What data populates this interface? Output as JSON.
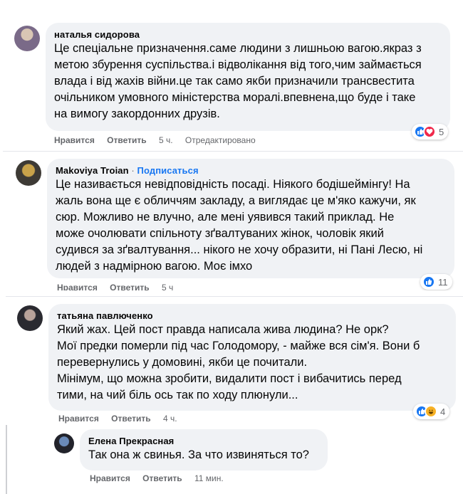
{
  "comments": [
    {
      "author": "наталья сидорова",
      "lines": [
        "Це спеціальне призначення.саме людини з лишньою вагою.якраз з",
        "метою збурення суспільства.і відволікання від того,чим займається",
        "влада і від жахів війни.це так само якби призначили трансвестита",
        "очільником умовного міністерства моралі.впевнена,що буде і таке",
        "на вимогу закордонних друзів."
      ],
      "like": "Нравится",
      "reply": "Ответить",
      "time": "5 ч.",
      "edited": "Отредактировано",
      "reaction_count": "5",
      "reactions": [
        "like-icon",
        "love-icon"
      ]
    },
    {
      "author": "Makoviya Troian",
      "separator": "·",
      "subscribe": "Подписаться",
      "lines": [
        "Це називається невідповідність посаді. Ніякого бодішеймінгу! На",
        "жаль вона ще є обличчям закладу, а виглядає це м'яко кажучи, як",
        "сюр. Можливо не влучно, але мені уявився такий приклад. Не",
        "може очолювати спільноту зґвалтуваних жінок, чоловік який",
        "судився за зґвалтування... нікого не хочу образити, ні Пані Лесю, ні",
        "людей з надмірною вагою. Моє імхо"
      ],
      "like": "Нравится",
      "reply": "Ответить",
      "time": "5 ч",
      "reaction_count": "11",
      "reactions": [
        "like-icon"
      ]
    },
    {
      "author": "татьяна павлюченко",
      "lines": [
        "Який жах. Цей пост правда написала жива людина? Не орк?",
        "Мої предки померли під час Голодомору, - майже вся сім'я. Вони б",
        "перевернулись у домовині, якби це почитали.",
        "Мінімум, що можна зробити, видалити пост і вибачитись перед",
        "тими, на чий біль ось так по ходу плюнули..."
      ],
      "like": "Нравится",
      "reply": "Ответить",
      "time": "4 ч.",
      "reaction_count": "4",
      "reactions": [
        "like-icon",
        "haha-icon"
      ]
    },
    {
      "author": "Елена Прекрасная",
      "lines": [
        "Так она ж свинья. За что извиняться то?"
      ],
      "like": "Нравится",
      "reply": "Ответить",
      "time": "11 мин."
    }
  ],
  "colors": {
    "bubble": "#f0f2f5",
    "link": "#1877f2",
    "meta": "#65676b",
    "like": "#1877f2",
    "love": "#f0284a",
    "haha": "#f7b125"
  }
}
